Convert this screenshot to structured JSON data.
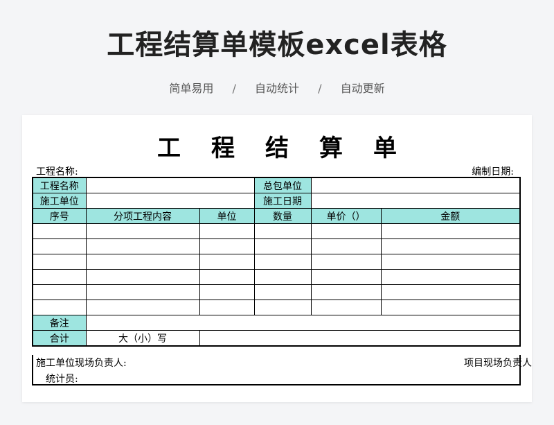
{
  "header": {
    "title": "工程结算单模板excel表格",
    "tags": [
      "简单易用",
      "自动统计",
      "自动更新"
    ],
    "separator": "/"
  },
  "document": {
    "title_chars": [
      "工",
      "程",
      "结",
      "算",
      "单"
    ],
    "project_name_label": "工程名称:",
    "date_label": "编制日期:",
    "info_rows": [
      {
        "label1": "工程名称",
        "label2": "总包单位"
      },
      {
        "label1": "施工单位",
        "label2": "施工日期"
      }
    ],
    "columns": [
      "序号",
      "分项工程内容",
      "单位",
      "数量",
      "单价（）",
      "金额"
    ],
    "empty_rows": 6,
    "remark_label": "备注",
    "total_label": "合计",
    "total_words": "大（小）写",
    "footer": {
      "site_manager": "施工单位现场负责人:",
      "project_manager": "项目现场负责人",
      "statistician": "统计员:"
    }
  },
  "colors": {
    "header_fill": "#9ee5e0",
    "background": "#f4f5f7"
  }
}
